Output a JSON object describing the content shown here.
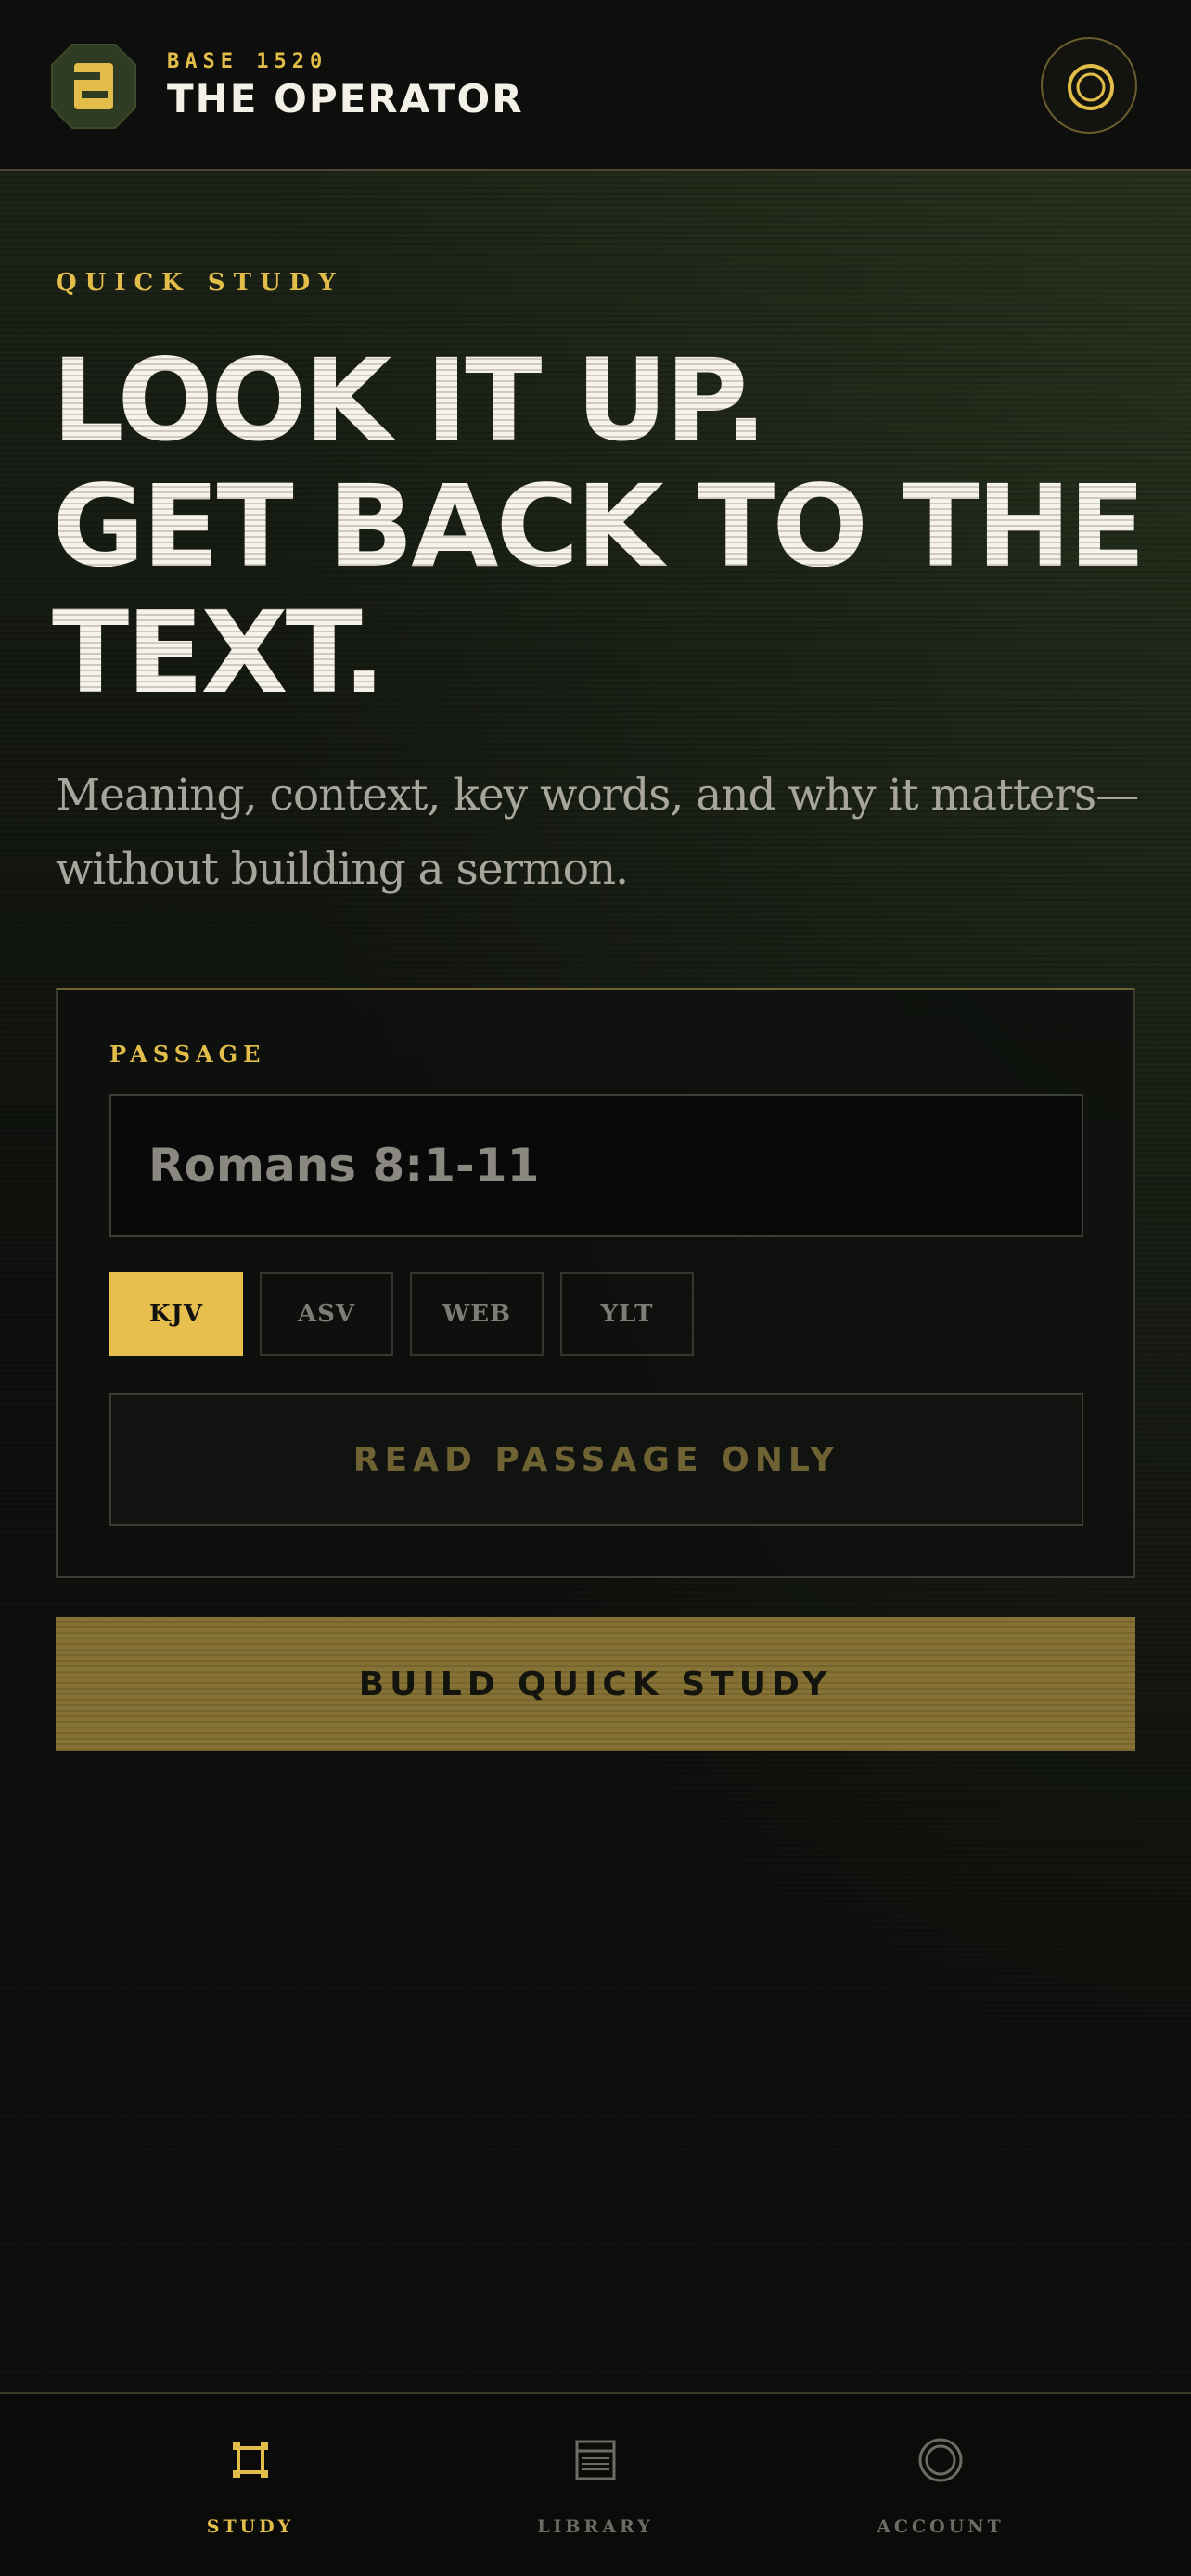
{
  "header": {
    "brand_sub": "BASE 1520",
    "brand_title": "THE OPERATOR",
    "logo_letter": "B",
    "icons": {
      "logo": "b-logo-icon",
      "action": "target-ring-icon"
    }
  },
  "main": {
    "eyebrow": "QUICK STUDY",
    "headline_lines": [
      "LOOK IT UP.",
      "GET BACK TO THE",
      "TEXT."
    ],
    "subhead_lines": [
      "Meaning, context, key words, and why it matters—",
      "without building a sermon."
    ]
  },
  "card": {
    "label": "PASSAGE",
    "passage_value": "",
    "passage_placeholder": "Romans 8:1-11",
    "versions": [
      "KJV",
      "ASV",
      "WEB",
      "YLT"
    ],
    "selected_version": "KJV",
    "read_only_label": "READ PASSAGE ONLY"
  },
  "build_label": "BUILD QUICK STUDY",
  "nav": {
    "items": [
      {
        "label": "STUDY",
        "icon": "study-frame-icon",
        "active": true
      },
      {
        "label": "LIBRARY",
        "icon": "library-lines-icon",
        "active": false
      },
      {
        "label": "ACCOUNT",
        "icon": "account-ring-icon",
        "active": false
      }
    ]
  },
  "colors": {
    "accent": "#e3bd4a",
    "background": "#0e100d",
    "text": "#f3f0e7",
    "muted": "#a8a69c"
  }
}
